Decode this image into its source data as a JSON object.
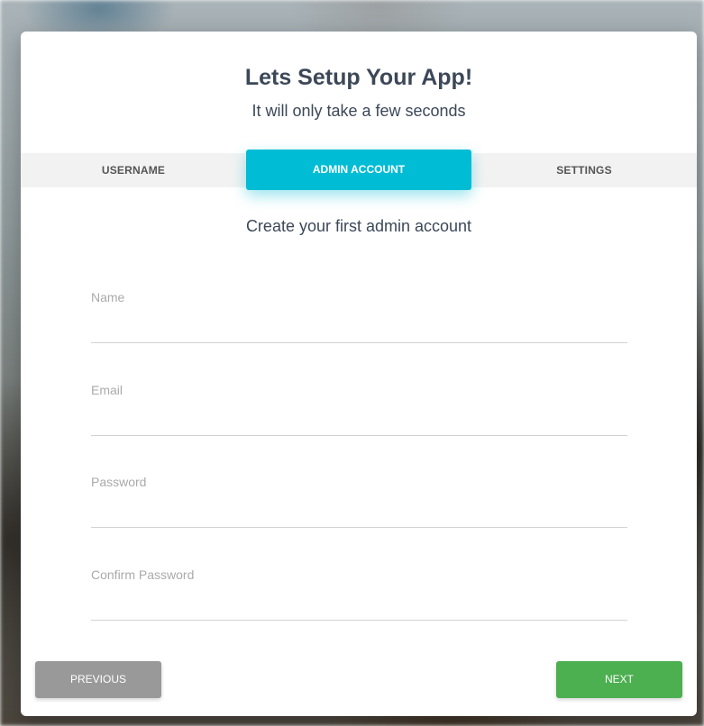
{
  "header": {
    "title": "Lets Setup Your App!",
    "subtitle": "It will only take a few seconds"
  },
  "tabs": [
    {
      "label": "USERNAME",
      "active": false
    },
    {
      "label": "ADMIN ACCOUNT",
      "active": true
    },
    {
      "label": "SETTINGS",
      "active": false
    }
  ],
  "section": {
    "heading": "Create your first admin account"
  },
  "form": {
    "name": {
      "label": "Name",
      "value": ""
    },
    "email": {
      "label": "Email",
      "value": ""
    },
    "password": {
      "label": "Password",
      "value": ""
    },
    "confirm_password": {
      "label": "Confirm Password",
      "value": ""
    }
  },
  "buttons": {
    "previous": "PREVIOUS",
    "next": "NEXT"
  },
  "colors": {
    "accent": "#00bcd4",
    "next": "#4caf50",
    "previous": "#999999",
    "text": "#3c4858"
  }
}
